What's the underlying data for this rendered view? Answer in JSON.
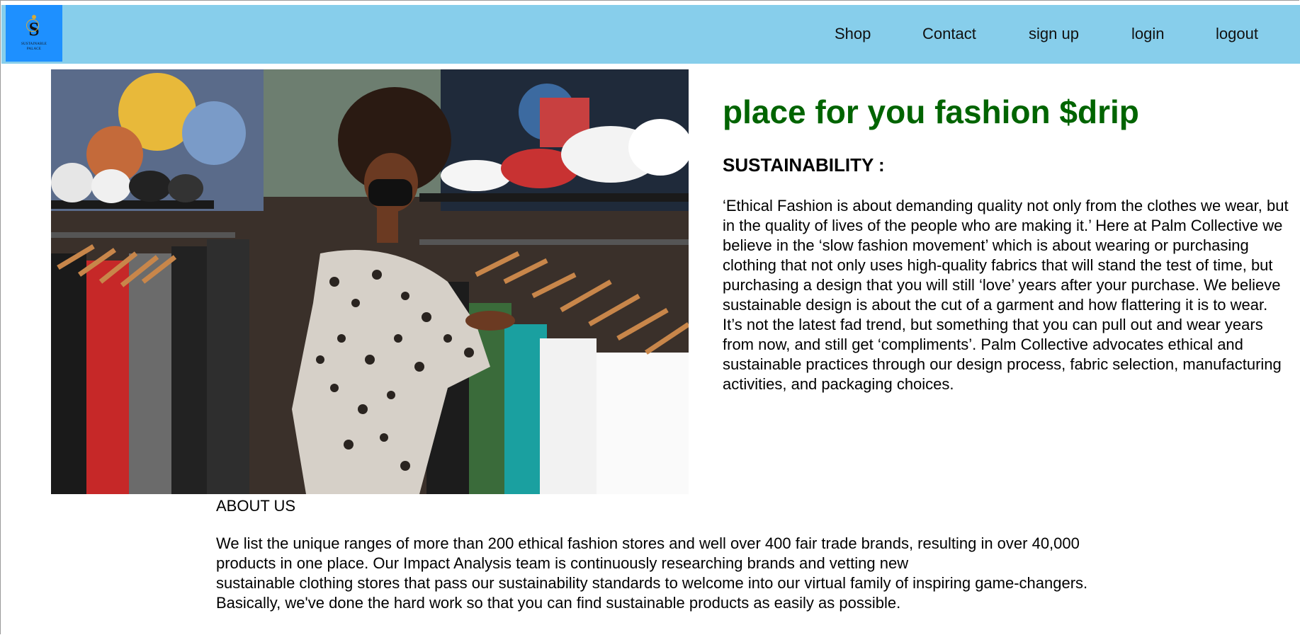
{
  "logo": {
    "letter": "S",
    "line1": "SUSTAINABLE",
    "line2": "PALACE"
  },
  "nav": {
    "items": [
      {
        "label": "Shop"
      },
      {
        "label": "Contact"
      },
      {
        "label": "sign up"
      },
      {
        "label": "login"
      },
      {
        "label": "logout"
      }
    ]
  },
  "hero": {
    "headline": "place for you fashion $drip",
    "subheading": "SUSTAINABILITY :",
    "paragraph": "‘Ethical Fashion is about demanding quality not only from the clothes we wear, but in the quality of lives of the people who are making it.’ Here at Palm Collective we believe in the ‘slow fashion movement’ which is about wearing or purchasing clothing that not only uses high-quality fabrics that will stand the test of time, but purchasing a design that you will still ‘love’ years after your purchase. We believe sustainable design is about the cut of a garment and how flattering it is to wear. It’s not the latest fad trend, but something that you can pull out and wear years from now, and still get ‘compliments’. Palm Collective advocates ethical and sustainable practices through our design process, fabric selection, manufacturing activities, and packaging choices."
  },
  "about": {
    "title": "ABOUT US",
    "lines": [
      "We list the unique ranges of more than 200 ethical fashion stores and well over 400 fair trade brands, resulting in over 40,000",
      "products in one place. Our Impact Analysis team is continuously researching brands and vetting new",
      "sustainable clothing stores that pass our sustainability standards to welcome into our virtual family of inspiring game-changers.",
      "Basically, we've done the hard work so that you can find sustainable products as easily as possible."
    ]
  },
  "colors": {
    "navbar": "#87ceeb",
    "logo_bg": "#1e90ff",
    "headline": "#006400"
  }
}
